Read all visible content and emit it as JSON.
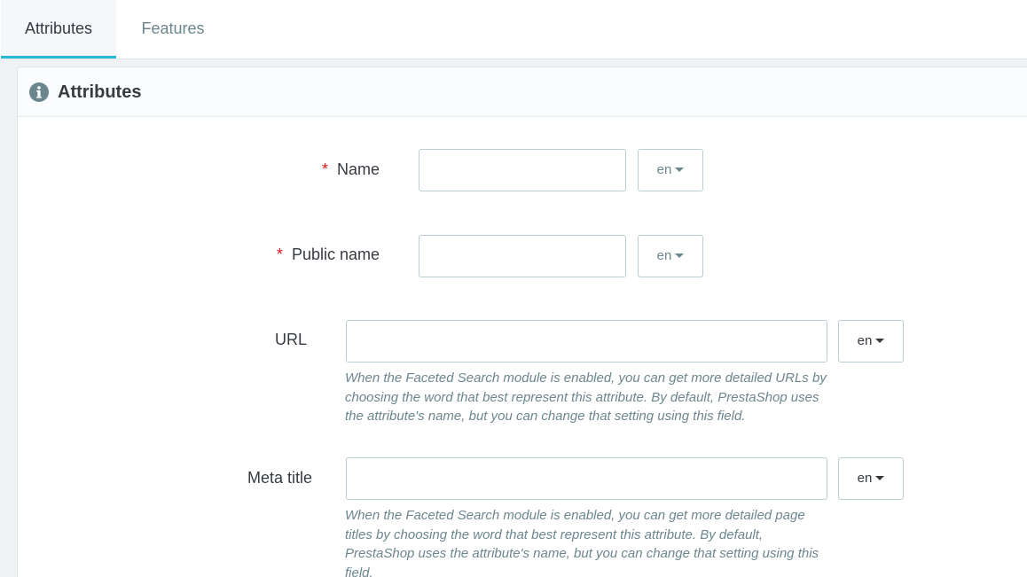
{
  "tabs": [
    {
      "label": "Attributes",
      "active": true
    },
    {
      "label": "Features",
      "active": false
    }
  ],
  "panel": {
    "title": "Attributes",
    "icon": "info-circle-icon"
  },
  "fields": {
    "name": {
      "label": "Name",
      "required_mark": "*",
      "value": "",
      "lang": "en"
    },
    "public_name": {
      "label": "Public name",
      "required_mark": "*",
      "value": "",
      "lang": "en"
    },
    "url": {
      "label": "URL",
      "value": "",
      "lang": "en",
      "help": "When the Faceted Search module is enabled, you can get more detailed URLs by choosing the word that best represent this attribute. By default, PrestaShop uses the attribute's name, but you can change that setting using this field."
    },
    "meta_title": {
      "label": "Meta title",
      "value": "",
      "lang": "en",
      "help": "When the Faceted Search module is enabled, you can get more detailed page titles by choosing the word that best represent this attribute. By default, PrestaShop uses the attribute's name, but you can change that setting using this field."
    }
  },
  "colors": {
    "accent": "#25b9d7",
    "required": "#e7171f",
    "border": "#bbcdd2",
    "muted_text": "#6c868e"
  }
}
